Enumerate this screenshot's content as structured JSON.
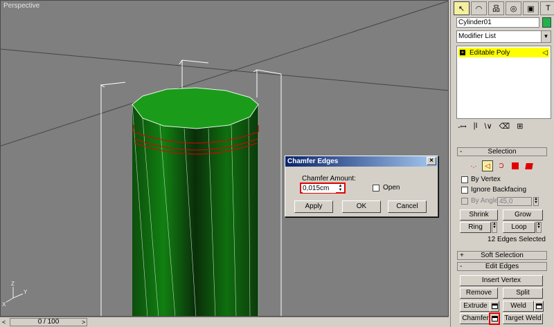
{
  "viewport": {
    "label": "Perspective",
    "axis_labels": {
      "x": "X",
      "y": "Y",
      "z": "Z"
    }
  },
  "timeline": {
    "frame": "0 / 100",
    "prev_arrow": "<",
    "next_arrow": ">"
  },
  "panel": {
    "tabs": [
      {
        "icon": "create-icon",
        "glyph": "↖",
        "active": true
      },
      {
        "icon": "modify-icon",
        "glyph": "◠",
        "active": false
      },
      {
        "icon": "hierarchy-icon",
        "glyph": "品",
        "active": false
      },
      {
        "icon": "motion-icon",
        "glyph": "◎",
        "active": false
      },
      {
        "icon": "display-icon",
        "glyph": "▣",
        "active": false
      },
      {
        "icon": "utilities-icon",
        "glyph": "T",
        "active": false
      }
    ],
    "object_name": "Cylinder01",
    "object_color": "#22b14c",
    "modifier_list": "Modifier List",
    "stack_item": "Editable Poly",
    "stack_tools": [
      "-ꟷ",
      "|Ӏ",
      "\\∨",
      "⌫",
      "⊞"
    ],
    "selection": {
      "title": "Selection",
      "by_vertex": "By Vertex",
      "ignore_backfacing": "Ignore Backfacing",
      "by_angle": "By Angle:",
      "angle_value": "45,0",
      "shrink": "Shrink",
      "grow": "Grow",
      "ring": "Ring",
      "loop": "Loop",
      "count": "12 Edges Selected"
    },
    "soft_selection": {
      "title": "Soft Selection"
    },
    "edit_edges": {
      "title": "Edit Edges",
      "insert_vertex": "Insert Vertex",
      "remove": "Remove",
      "split": "Split",
      "extrude": "Extrude",
      "weld": "Weld",
      "chamfer": "Chamfer",
      "target_weld": "Target Weld"
    }
  },
  "dialog": {
    "title": "Chamfer Edges",
    "close": "×",
    "amount_label": "Chamfer Amount:",
    "amount_value": "0,015cm",
    "open_label": "Open",
    "apply": "Apply",
    "ok": "OK",
    "cancel": "Cancel"
  },
  "colors": {
    "cylinder": "#1a9c1a",
    "cylinder_dark": "#0a3a0a",
    "selection_edges": "#e00000",
    "highlight": "#ffff00"
  }
}
